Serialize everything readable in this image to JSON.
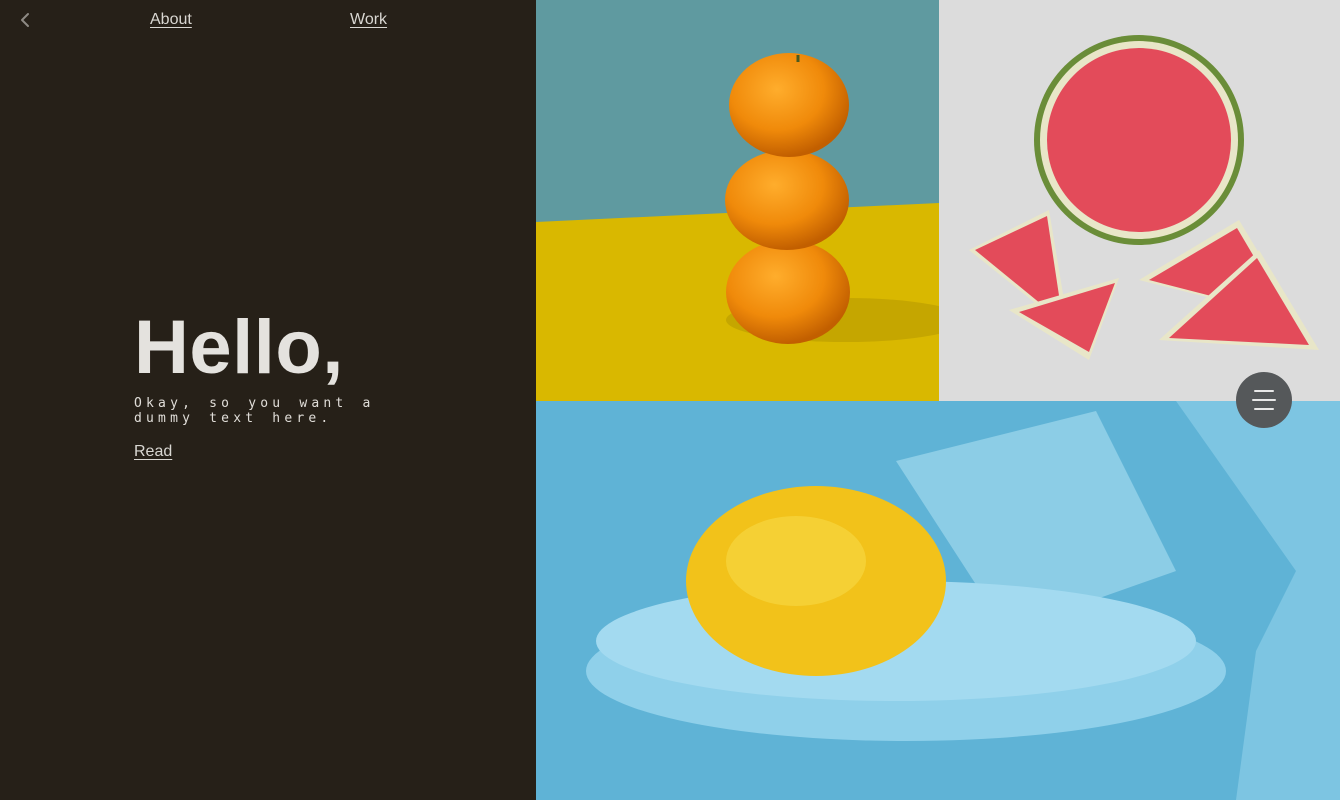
{
  "nav": {
    "back_icon": "chevron-left-icon",
    "links": [
      "About",
      "Work"
    ]
  },
  "hero": {
    "title": "Hello,",
    "subtitle": "Okay, so you want a dummy text here.",
    "cta": "Read"
  },
  "gallery": {
    "images": [
      "oranges",
      "watermelon",
      "lemon"
    ]
  },
  "menu": {
    "icon": "hamburger-menu-icon"
  },
  "colors": {
    "background": "#262018",
    "text": "#e4e2de",
    "oranges_bg_top": "#5f9aa0",
    "oranges_bg_bottom": "#d9b800",
    "lemon_bg": "#5fb3d6",
    "menu_button": "#55585a"
  }
}
